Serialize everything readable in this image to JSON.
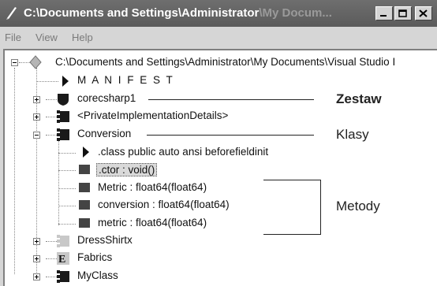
{
  "window": {
    "title_main": "C:\\Documents and Settings\\Administrator",
    "title_dim": "\\My Docum...",
    "buttons": [
      "minimize",
      "maximize",
      "close"
    ]
  },
  "menu": [
    "File",
    "View",
    "Help"
  ],
  "tree": {
    "root_label": "C:\\Documents and Settings\\Administrator\\My Documents\\Visual Studio I",
    "manifest": "M A N I F E S T",
    "corecsharp": "corecsharp1",
    "private": "<PrivateImplementationDetails>",
    "conversion": "Conversion",
    "class_decl": ".class public auto ansi beforefieldinit",
    "ctor": ".ctor : void()",
    "metric_upper": "Metric : float64(float64)",
    "conversion_m": "conversion : float64(float64)",
    "metric_lower": "metric : float64(float64)",
    "dressshirtx": "DressShirtx",
    "fabrics": "Fabrics",
    "myclass": "MyClass"
  },
  "annotations": {
    "assembly": "Zestaw",
    "classes": "Klasy",
    "methods": "Metody"
  },
  "colors": {
    "titlebar": "#5b5b5b",
    "chrome": "#d6d6d6",
    "icon_dark": "#1a1a1a",
    "icon_light": "#c8c8c8"
  }
}
